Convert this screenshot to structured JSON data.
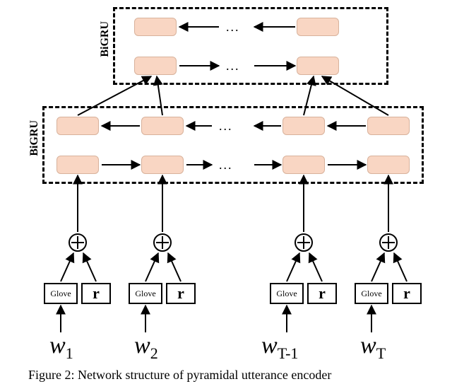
{
  "chart_data": {
    "type": "diagram",
    "description": "Pyramidal utterance encoder network structure",
    "inputs": [
      {
        "token": "w1",
        "embeddings": [
          "Glove",
          "r"
        ]
      },
      {
        "token": "w2",
        "embeddings": [
          "Glove",
          "r"
        ]
      },
      {
        "token": "wT-1",
        "embeddings": [
          "Glove",
          "r"
        ]
      },
      {
        "token": "wT",
        "embeddings": [
          "Glove",
          "r"
        ]
      }
    ],
    "fusion_op": "⊕",
    "layers": [
      {
        "name": "BiGRU",
        "level": 1,
        "direction": "bidirectional",
        "units_shown": 4
      },
      {
        "name": "BiGRU",
        "level": 2,
        "direction": "bidirectional",
        "units_shown": 2
      }
    ],
    "pyramid_ratio": 2
  },
  "labels": {
    "glove": "Glove",
    "r": "r",
    "bgru": "BiGRU",
    "w1": "w",
    "w1_sub": "1",
    "w2": "w",
    "w2_sub": "2",
    "w3": "w",
    "w3_sub": "T-1",
    "w4": "w",
    "w4_sub": "T",
    "ellipsis": "..."
  },
  "caption": "Figure 2: Network structure of pyramidal utterance encoder"
}
